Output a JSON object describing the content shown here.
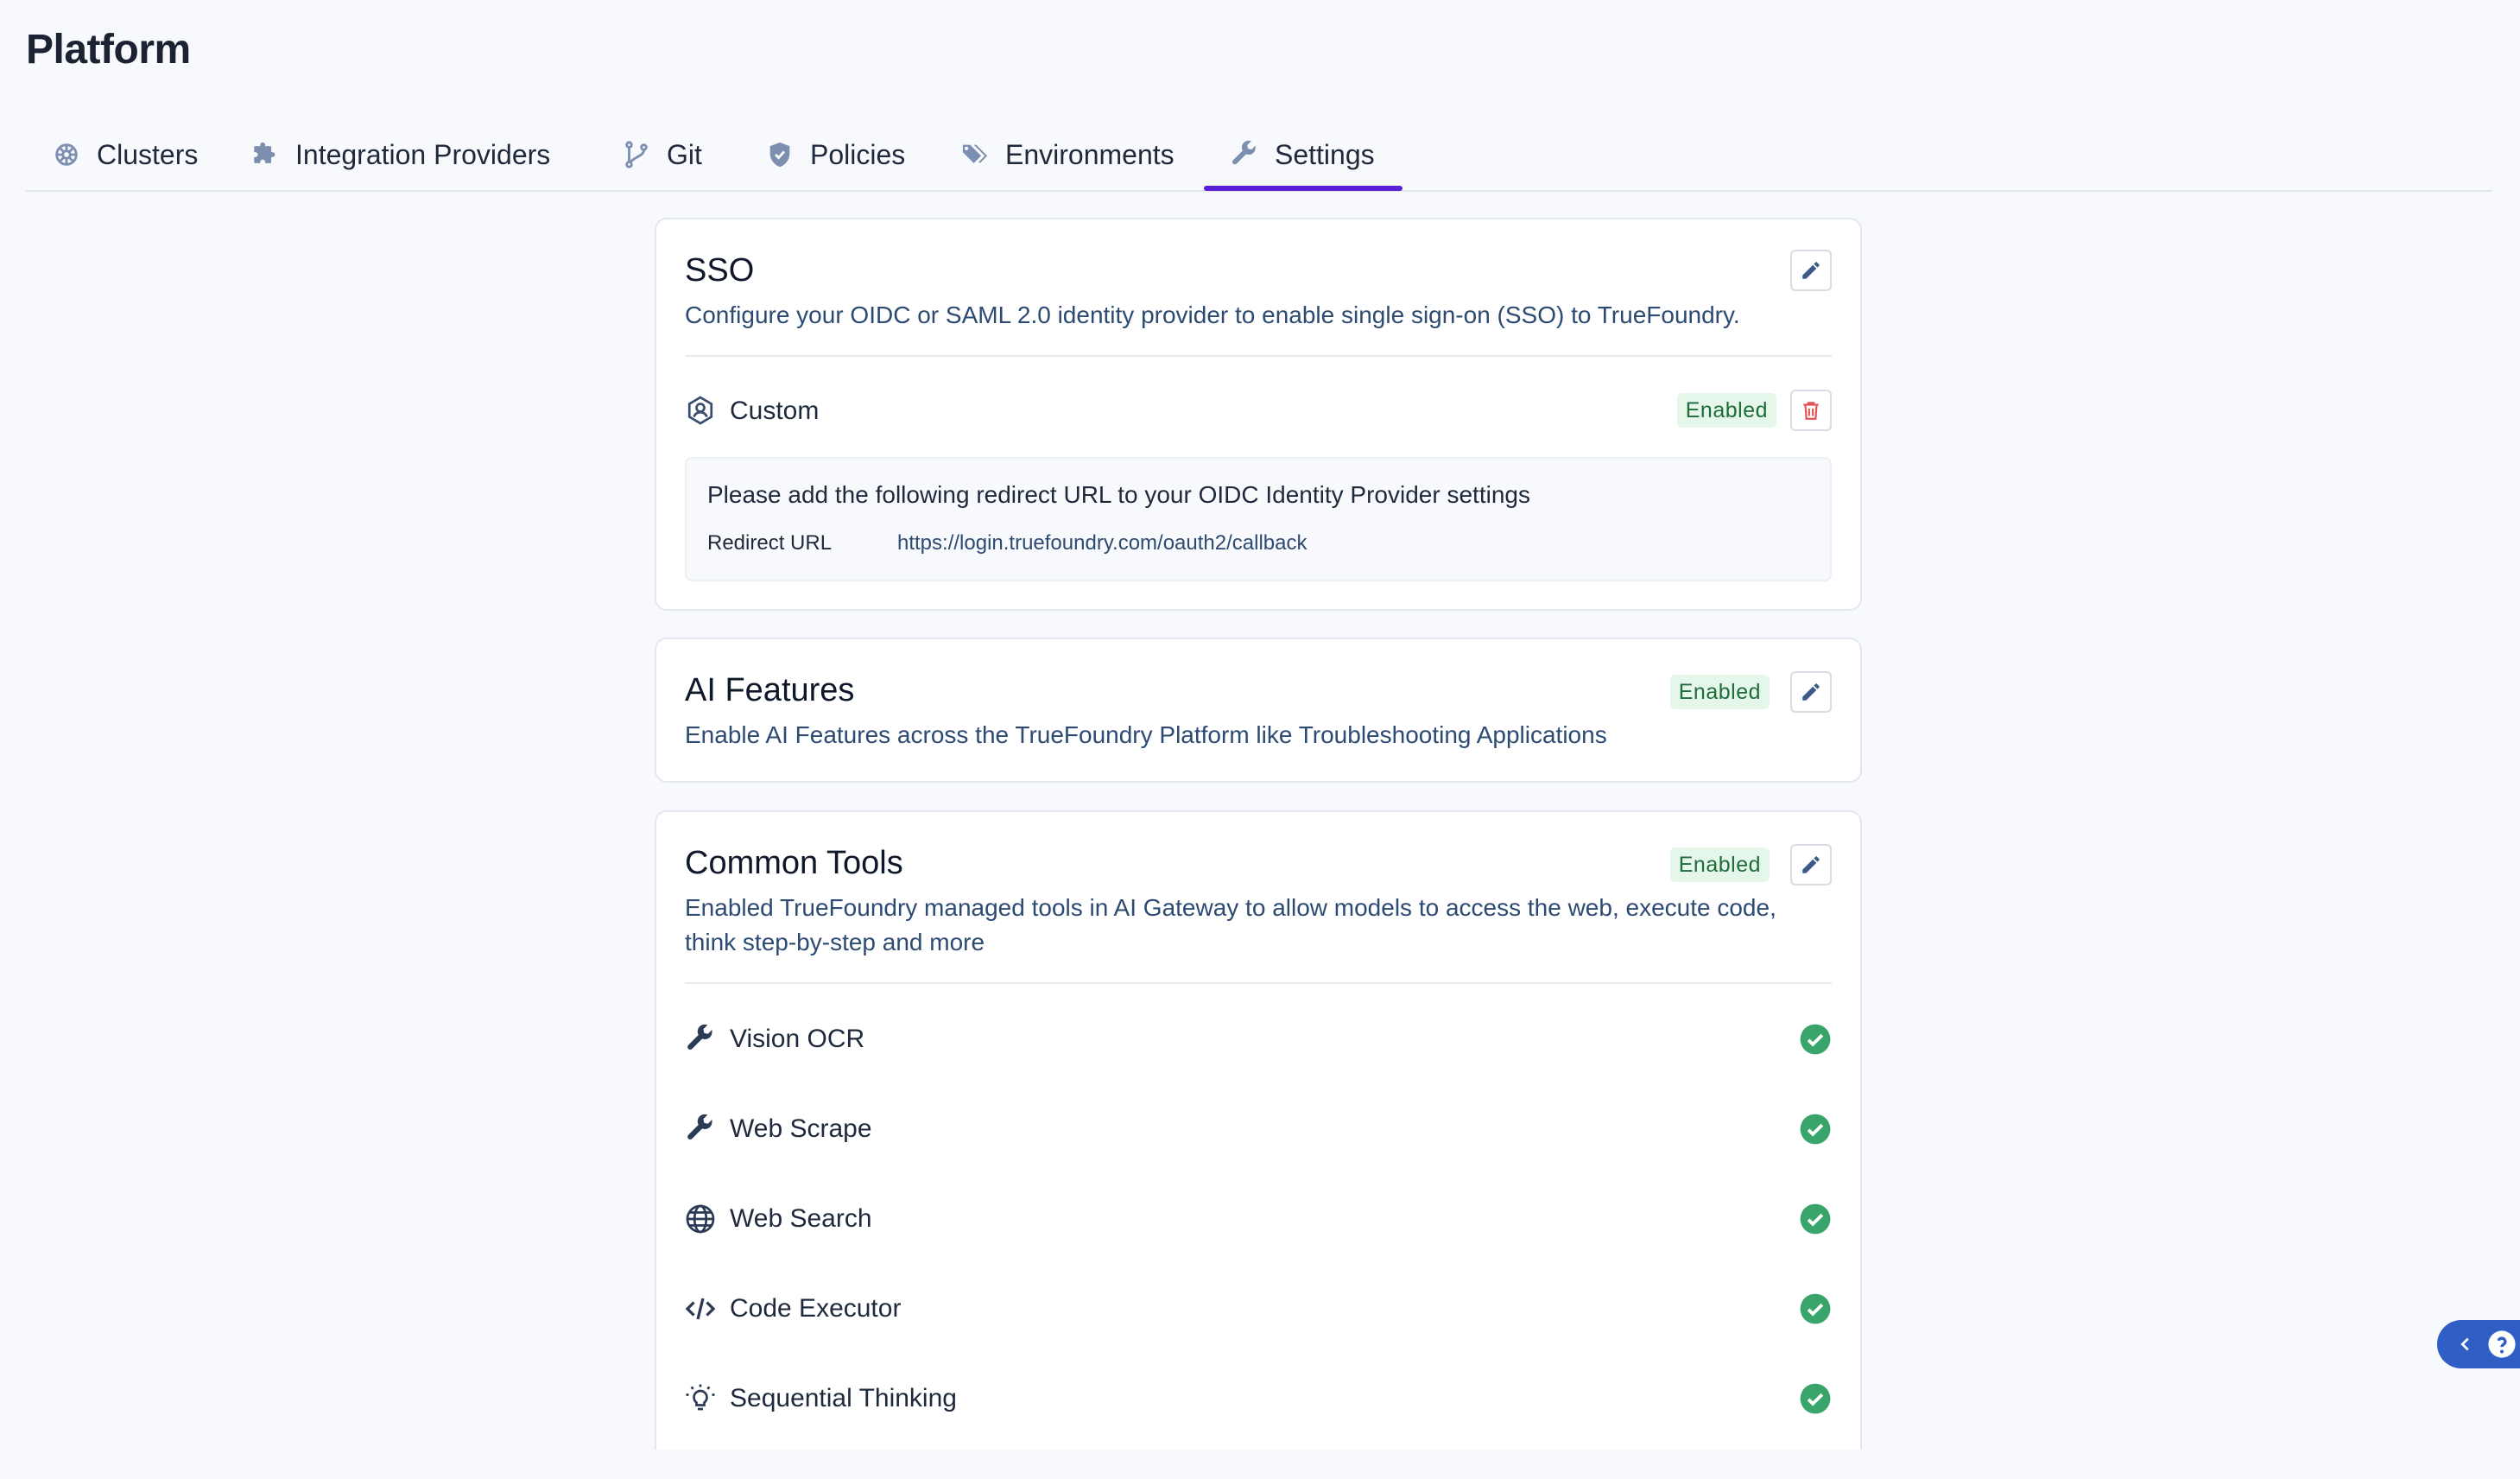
{
  "page": {
    "title": "Platform"
  },
  "tabs": [
    {
      "label": "Clusters",
      "icon": "cluster-icon"
    },
    {
      "label": "Integration Providers",
      "icon": "puzzle-icon"
    },
    {
      "label": "Git",
      "icon": "git-branch-icon"
    },
    {
      "label": "Policies",
      "icon": "shield-icon"
    },
    {
      "label": "Environments",
      "icon": "tags-icon"
    },
    {
      "label": "Settings",
      "icon": "wrench-icon",
      "active": true
    }
  ],
  "sso": {
    "title": "SSO",
    "description": "Configure your OIDC or SAML 2.0 identity provider to enable single sign-on (SSO) to TrueFoundry.",
    "provider": {
      "name": "Custom",
      "status": "Enabled"
    },
    "info": {
      "message": "Please add the following redirect URL to your OIDC Identity Provider settings",
      "redirect_label": "Redirect URL",
      "redirect_url": "https://login.truefoundry.com/oauth2/callback"
    }
  },
  "ai_features": {
    "title": "AI Features",
    "status": "Enabled",
    "description": "Enable AI Features across the TrueFoundry Platform like Troubleshooting Applications"
  },
  "common_tools": {
    "title": "Common Tools",
    "status": "Enabled",
    "description_line1": "Enabled TrueFoundry managed tools in AI Gateway to allow models to access the web, execute code,",
    "description_line2": "think step-by-step and more",
    "tools": [
      {
        "name": "Vision OCR",
        "icon": "wrench-icon",
        "enabled": true
      },
      {
        "name": "Web Scrape",
        "icon": "wrench-icon",
        "enabled": true
      },
      {
        "name": "Web Search",
        "icon": "globe-icon",
        "enabled": true
      },
      {
        "name": "Code Executor",
        "icon": "code-icon",
        "enabled": true
      },
      {
        "name": "Sequential Thinking",
        "icon": "lightbulb-icon",
        "enabled": true
      }
    ]
  },
  "colors": {
    "accent": "#5b21d6",
    "enabled_badge_bg": "#e5f7ea",
    "enabled_badge_text": "#1f6b3a",
    "check_green": "#3aa56a",
    "delete_red": "#e25555",
    "help_button": "#2f5fc4"
  }
}
